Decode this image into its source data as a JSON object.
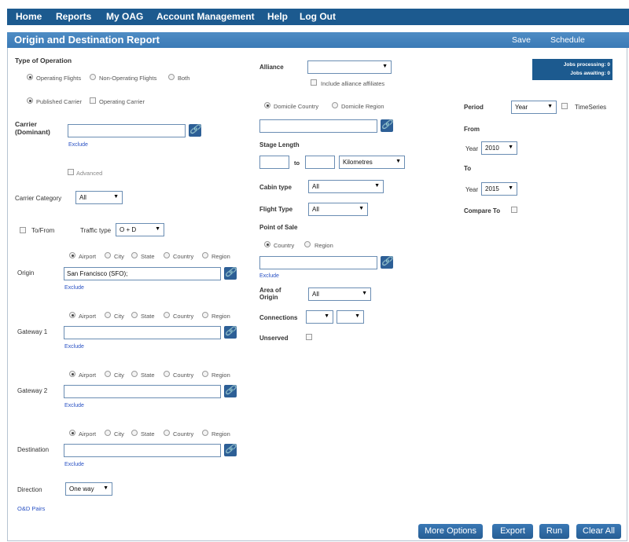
{
  "nav": {
    "home": "Home",
    "reports": "Reports",
    "my_oag": "My OAG",
    "account": "Account Management",
    "help": "Help",
    "logout": "Log Out"
  },
  "title": {
    "text": "Origin and Destination Report",
    "save": "Save",
    "schedule": "Schedule"
  },
  "jobs": {
    "processing": "Jobs processing: 0",
    "awaiting": "Jobs awaiting:   0"
  },
  "left": {
    "type_of_operation": "Type of Operation",
    "op_operating": "Operating Flights",
    "op_non_operating": "Non-Operating Flights",
    "op_both": "Both",
    "published_carrier": "Published Carrier",
    "operating_carrier": "Operating Carrier",
    "carrier_label": "Carrier\n(Dominant)",
    "carrier_value": "",
    "exclude": "Exclude",
    "advanced": "Advanced",
    "carrier_category_label": "Carrier Category",
    "carrier_category_value": "All",
    "to_from": "To/From",
    "traffic_type_label": "Traffic type",
    "traffic_type_value": "O + D",
    "loc_airport": "Airport",
    "loc_city": "City",
    "loc_state": "State",
    "loc_country": "Country",
    "loc_region": "Region",
    "origin_label": "Origin",
    "origin_value": "San Francisco (SFO);",
    "gateway1_label": "Gateway 1",
    "gateway2_label": "Gateway 2",
    "destination_label": "Destination",
    "direction_label": "Direction",
    "direction_value": "One way",
    "od_pairs": "O&D Pairs"
  },
  "middle": {
    "alliance_label": "Alliance",
    "alliance_value": "",
    "include_affiliates": "Include alliance affiliates",
    "domicile_country": "Domicile Country",
    "domicile_region": "Domicile Region",
    "stage_length_label": "Stage Length",
    "to": "to",
    "units_value": "Kilometres",
    "cabin_type_label": "Cabin type",
    "cabin_type_value": "All",
    "flight_type_label": "Flight Type",
    "flight_type_value": "All",
    "point_of_sale_label": "Point of Sale",
    "pos_country": "Country",
    "pos_region": "Region",
    "exclude": "Exclude",
    "area_of_origin_label": "Area of\nOrigin",
    "area_of_origin_value": "All",
    "connections_label": "Connections",
    "unserved_label": "Unserved"
  },
  "right": {
    "period_label": "Period",
    "period_value": "Year",
    "timeseries": "TimeSeries",
    "from_label": "From",
    "year_label": "Year",
    "from_year": "2010",
    "to_label": "To",
    "to_year": "2015",
    "compare_to": "Compare To"
  },
  "buttons": {
    "more_options": "More Options",
    "export": "Export",
    "run": "Run",
    "clear_all": "Clear All"
  },
  "icons": {
    "picker": "paperclip-icon",
    "dropdown": "triangle-down-icon"
  }
}
